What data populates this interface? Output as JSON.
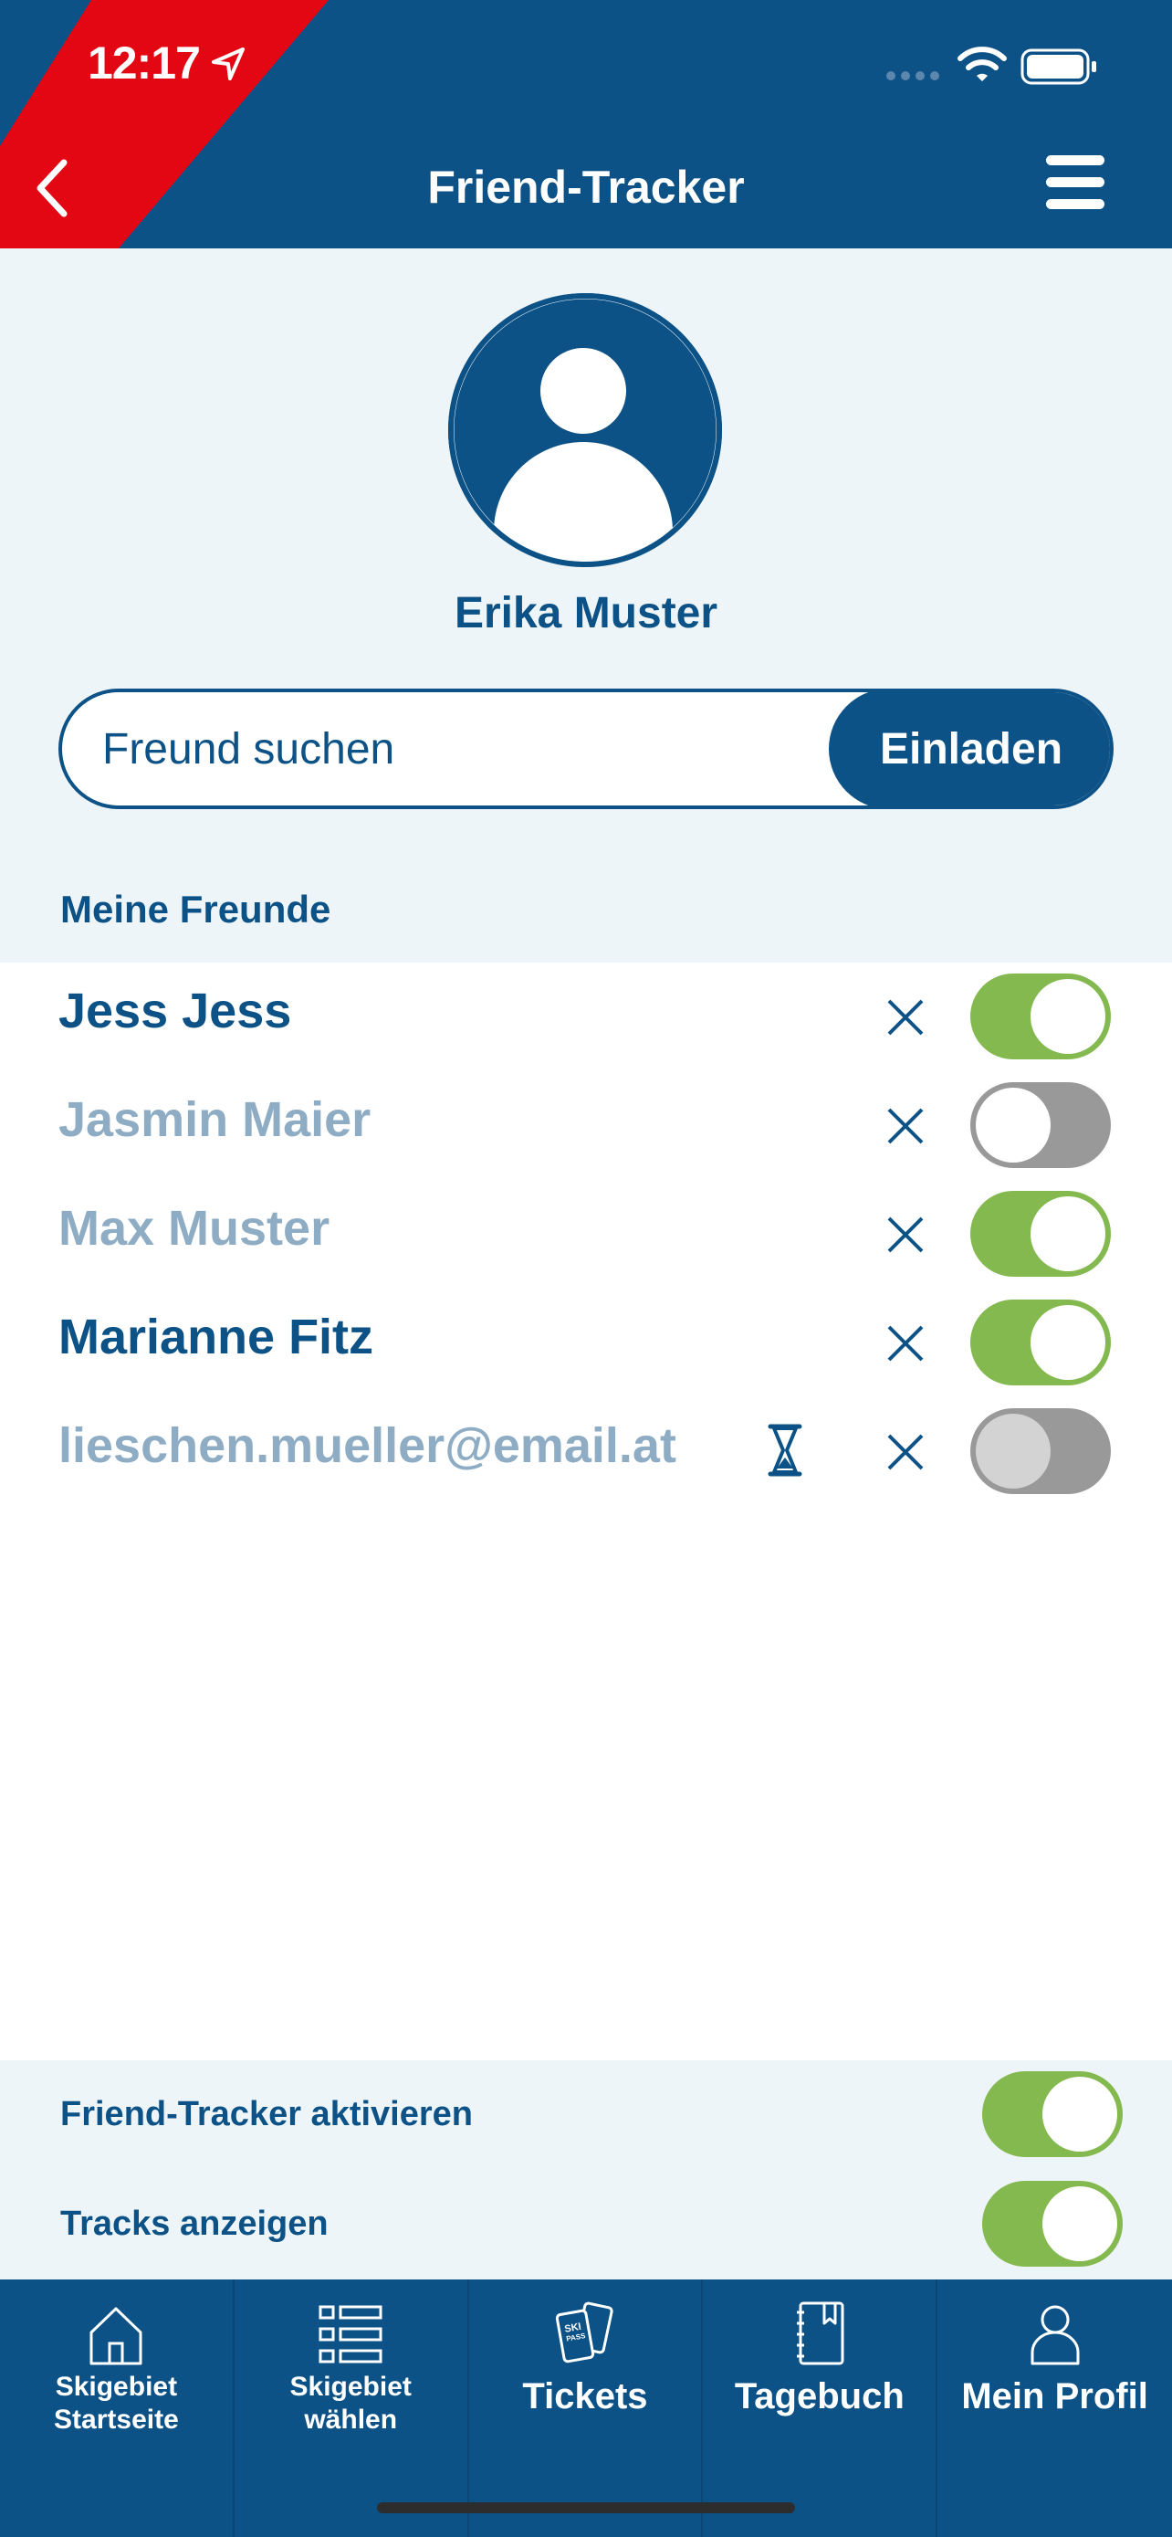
{
  "status_bar": {
    "time": "12:17"
  },
  "header": {
    "title": "Friend-Tracker"
  },
  "profile": {
    "name": "Erika Muster"
  },
  "search": {
    "placeholder": "Freund suchen",
    "value": "",
    "invite_label": "Einladen"
  },
  "friends_section": {
    "label": "Meine Freunde"
  },
  "friends": [
    {
      "name": "Jess Jess",
      "status": "active",
      "tracking": true,
      "pending": false
    },
    {
      "name": "Jasmin Maier",
      "status": "inactive",
      "tracking": false,
      "pending": false
    },
    {
      "name": "Max Muster",
      "status": "inactive",
      "tracking": true,
      "pending": false
    },
    {
      "name": "Marianne Fitz",
      "status": "active",
      "tracking": true,
      "pending": false
    },
    {
      "name": "lieschen.mueller@email.at",
      "status": "inactive",
      "tracking": false,
      "pending": true
    }
  ],
  "settings": [
    {
      "label": "Friend-Tracker aktivieren",
      "enabled": true
    },
    {
      "label": "Tracks anzeigen",
      "enabled": true
    }
  ],
  "tab_bar": {
    "items": [
      {
        "label_line1": "Skigebiet",
        "label_line2": "Startseite",
        "icon": "house-icon"
      },
      {
        "label_line1": "Skigebiet",
        "label_line2": "wählen",
        "icon": "list-icon"
      },
      {
        "label": "Tickets",
        "icon": "ski-pass-icon"
      },
      {
        "label": "Tagebuch",
        "icon": "diary-icon"
      },
      {
        "label": "Mein Profil",
        "icon": "profile-icon"
      }
    ]
  },
  "colors": {
    "brand_blue": "#0c5287",
    "accent_red": "#e30613",
    "toggle_on": "#84b950",
    "toggle_off": "#999999",
    "inactive_text": "#8eacc4",
    "section_bg": "#eef5f9"
  }
}
